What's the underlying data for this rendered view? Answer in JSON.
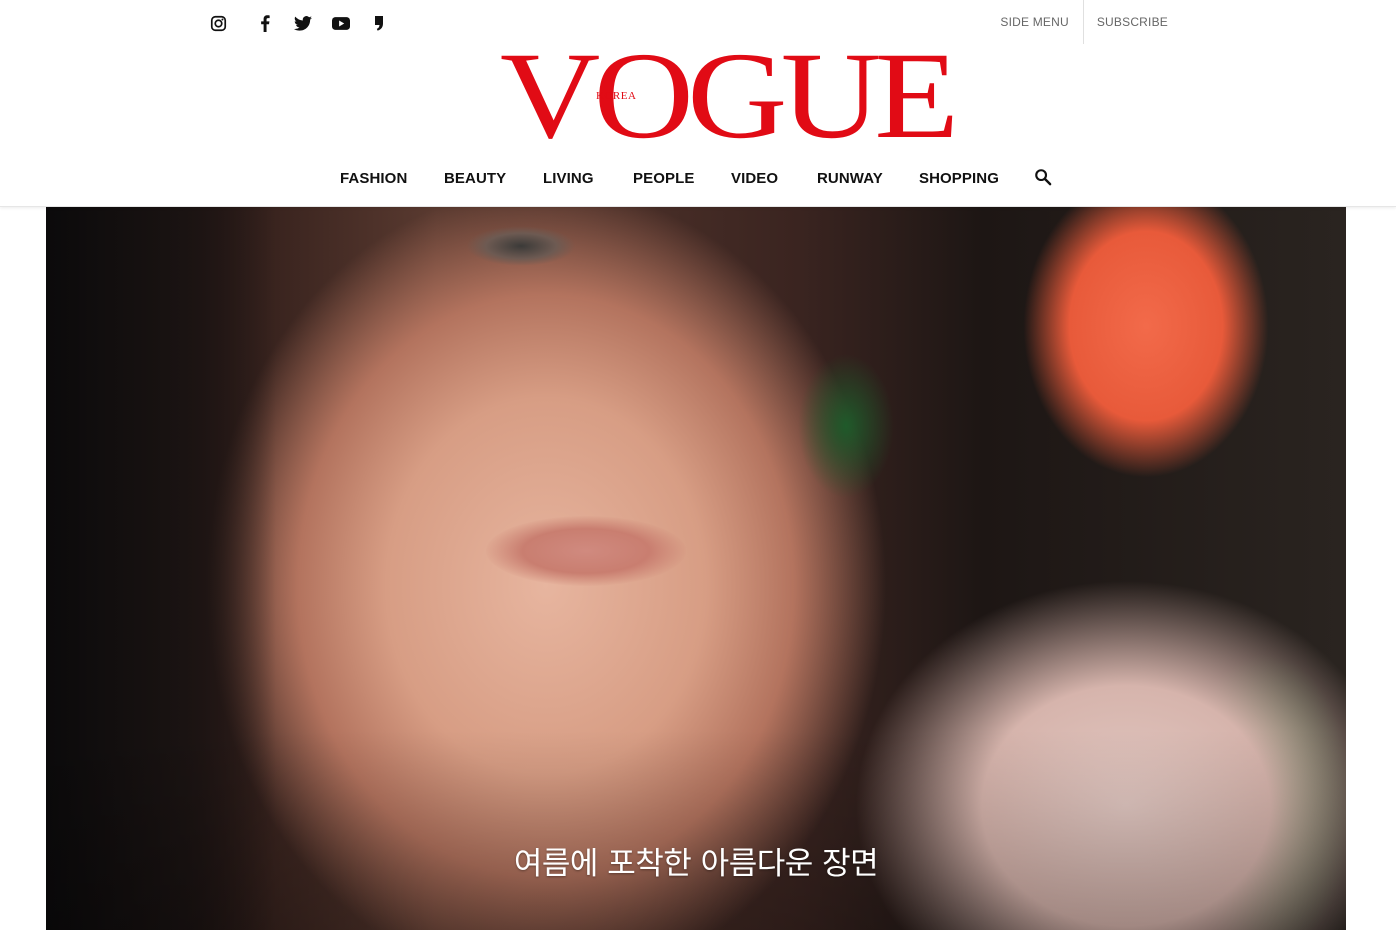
{
  "social": {
    "icons": [
      "instagram-icon",
      "facebook-icon",
      "twitter-icon",
      "youtube-icon",
      "comma-icon"
    ]
  },
  "top_links": {
    "side_menu": "SIDE MENU",
    "subscribe": "SUBSCRIBE"
  },
  "logo": {
    "text": "VOGUE",
    "subtext": "KOREA",
    "color": "#e10b15"
  },
  "nav": {
    "items": [
      "FASHION",
      "BEAUTY",
      "LIVING",
      "PEOPLE",
      "VIDEO",
      "RUNWAY",
      "SHOPPING"
    ],
    "search_icon": "search-icon"
  },
  "hero": {
    "caption": "여름에 포착한 아름다운 장면"
  }
}
